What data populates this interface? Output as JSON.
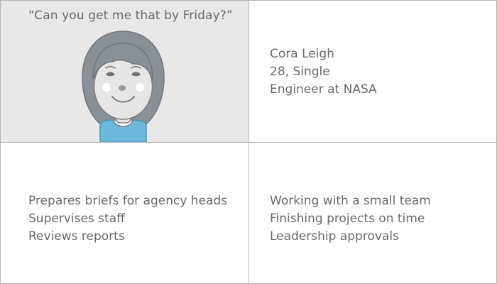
{
  "persona": {
    "quote": "“Can you get me that by Friday?”",
    "name": "Cora Leigh",
    "age_status": "28, Single",
    "occupation": "Engineer at NASA"
  },
  "responsibilities": [
    "Prepares briefs for agency heads",
    "Supervises staff",
    "Reviews reports"
  ],
  "priorities": [
    "Working with a small team",
    "Finishing projects on time",
    "Leadership approvals"
  ],
  "colors": {
    "portrait_background": "#e8e8e8",
    "hair": "#8a9097",
    "skin": "#e6e6e6",
    "shirt": "#6cb9dc",
    "grid_lines": "#b5b5b5",
    "text": "#6a6a6a"
  },
  "icons": {
    "avatar": "avatar-illustration"
  }
}
